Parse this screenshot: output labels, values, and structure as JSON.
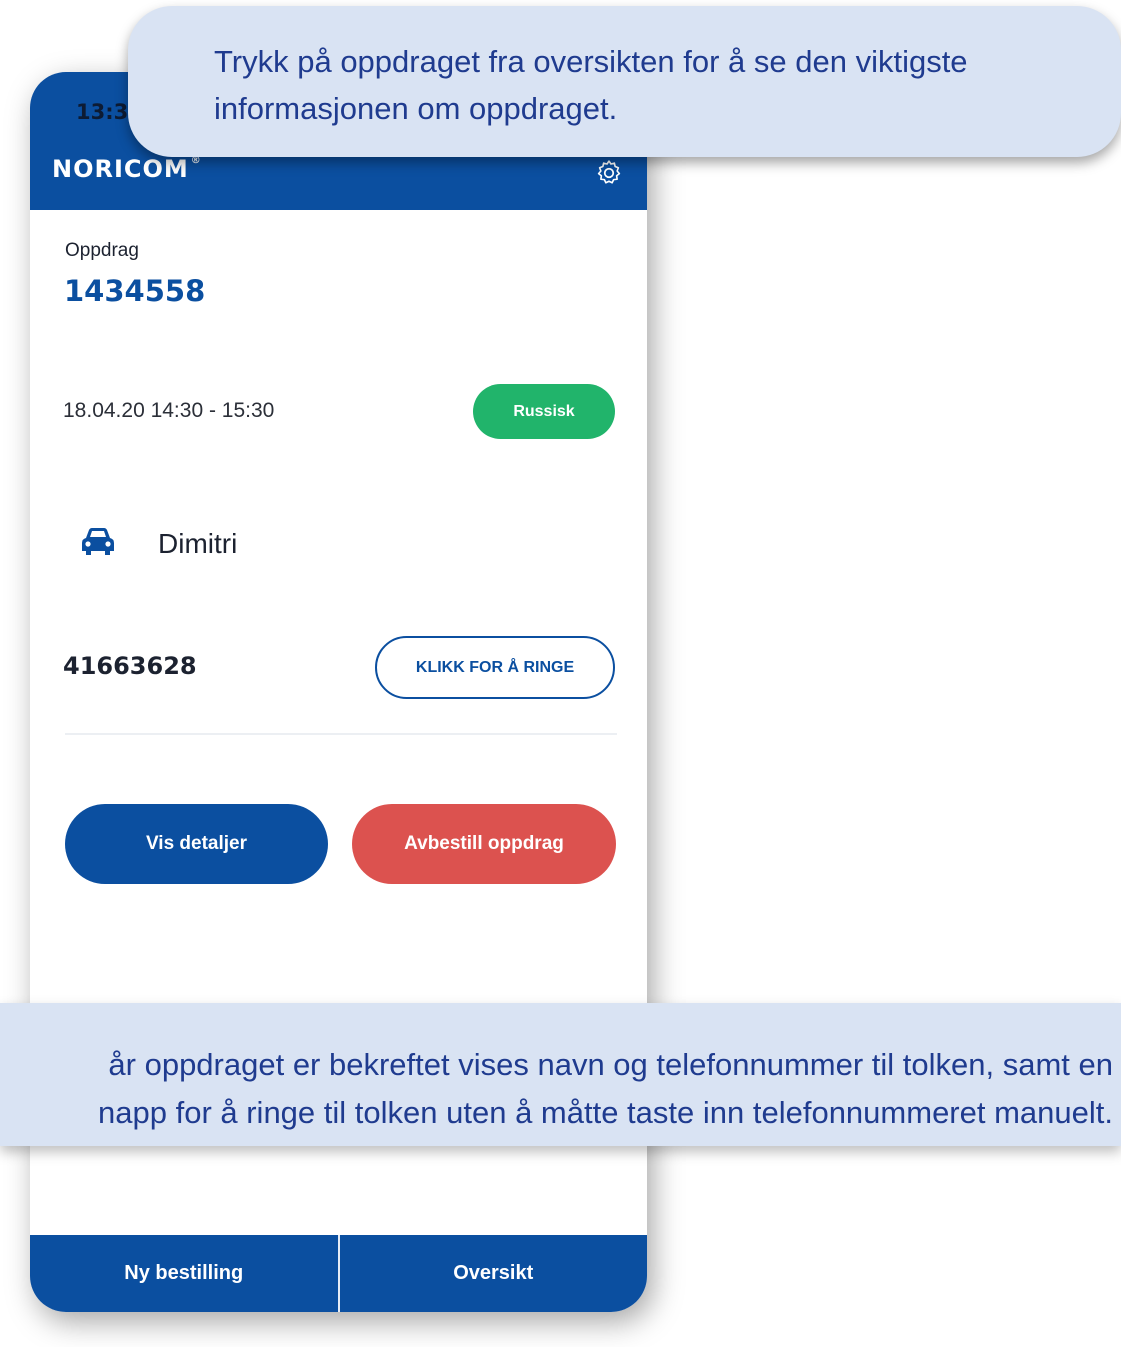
{
  "phone": {
    "status_time": "13:3",
    "brand": "NORICOM",
    "brand_mark": "®",
    "settings_icon": "gear-icon",
    "order_label": "Oppdrag",
    "order_number": "1434558",
    "datetime": "18.04.20 14:30 - 15:30",
    "language": "Russisk",
    "vehicle_icon": "car-icon",
    "interpreter_name": "Dimitri",
    "phone_number": "41663628",
    "call_button": "KLIKK FOR Å RINGE",
    "details_button": "Vis detaljer",
    "cancel_button": "Avbestill oppdrag",
    "nav": {
      "new_order": "Ny bestilling",
      "overview": "Oversikt"
    }
  },
  "callouts": {
    "top": [
      "Trykk på oppdraget fra oversikten for å se den viktigste",
      "informasjonen om oppdraget."
    ],
    "bottom": [
      "år oppdraget er bekreftet vises navn og telefonnummer til tolken, samt en",
      "napp for å ringe til tolken uten å måtte taste inn telefonnummeret manuelt."
    ]
  },
  "colors": {
    "brand_blue": "#0b4fa0",
    "language_green": "#21b46b",
    "cancel_red": "#dc524f",
    "callout_bg": "#d9e3f3",
    "callout_text": "#1f3b8f"
  }
}
